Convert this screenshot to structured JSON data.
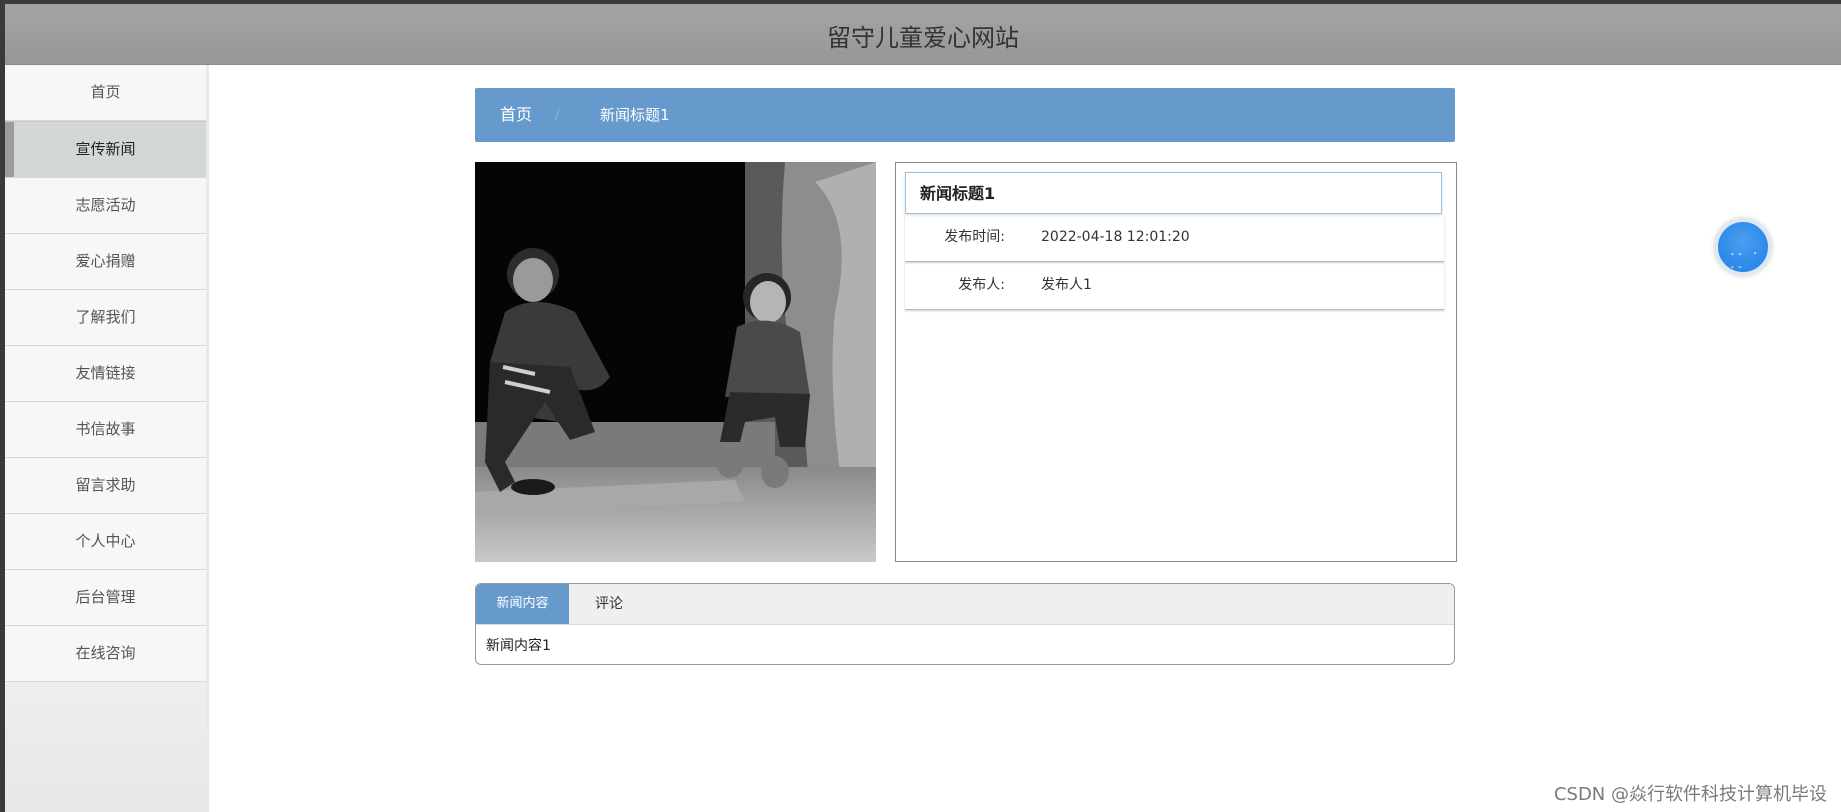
{
  "header": {
    "title": "留守儿童爱心网站"
  },
  "sidebar": {
    "items": [
      {
        "label": "首页",
        "active": false
      },
      {
        "label": "宣传新闻",
        "active": true
      },
      {
        "label": "志愿活动",
        "active": false
      },
      {
        "label": "爱心捐赠",
        "active": false
      },
      {
        "label": "了解我们",
        "active": false
      },
      {
        "label": "友情链接",
        "active": false
      },
      {
        "label": "书信故事",
        "active": false
      },
      {
        "label": "留言求助",
        "active": false
      },
      {
        "label": "个人中心",
        "active": false
      },
      {
        "label": "后台管理",
        "active": false
      },
      {
        "label": "在线咨询",
        "active": false
      }
    ]
  },
  "breadcrumb": {
    "home": "首页",
    "separator": "/",
    "current": "新闻标题1"
  },
  "article": {
    "title": "新闻标题1",
    "publish_time_label": "发布时间:",
    "publish_time": "2022-04-18 12:01:20",
    "publisher_label": "发布人:",
    "publisher": "发布人1"
  },
  "tabs": {
    "news_label": "新闻内容",
    "comment_label": "评论",
    "content": "新闻内容1"
  },
  "watermark": "CSDN @焱行软件科技计算机毕设",
  "colors": {
    "accent": "#6699cc",
    "header": "#9a9d9b",
    "float_button": "#2a8ae8"
  },
  "icons": {
    "float": "dash-icon"
  }
}
